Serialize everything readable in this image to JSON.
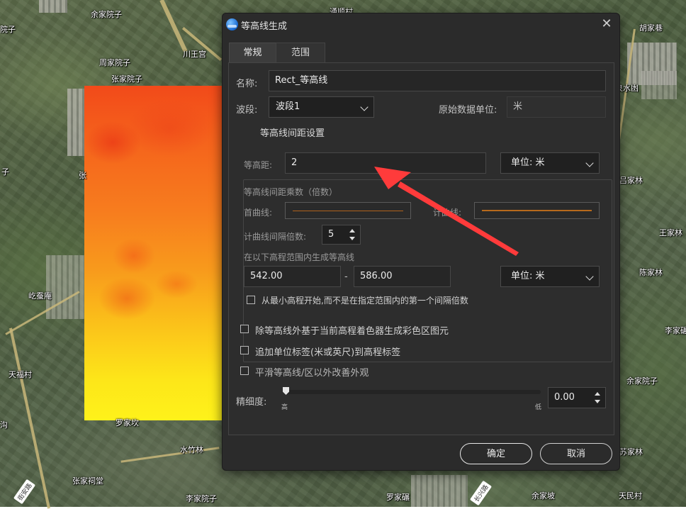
{
  "map": {
    "places": [
      {
        "id": "p1",
        "text": "余家院子"
      },
      {
        "id": "p2",
        "text": "通顺村"
      },
      {
        "id": "p3",
        "text": "胡家巷"
      },
      {
        "id": "p4",
        "text": "周家院子"
      },
      {
        "id": "p5",
        "text": "川王宫"
      },
      {
        "id": "p6",
        "text": "张家院子"
      },
      {
        "id": "p7",
        "text": "泉水凼"
      },
      {
        "id": "p8",
        "text": "吕家林"
      },
      {
        "id": "p9",
        "text": "王家林"
      },
      {
        "id": "p10",
        "text": "陈家林"
      },
      {
        "id": "p11",
        "text": "屹蚕庵"
      },
      {
        "id": "p12",
        "text": "李家碾"
      },
      {
        "id": "p13",
        "text": "天福村"
      },
      {
        "id": "p14",
        "text": "余家院子"
      },
      {
        "id": "p15",
        "text": "罗家坎"
      },
      {
        "id": "p16",
        "text": "水竹林"
      },
      {
        "id": "p17",
        "text": "张家祠堂"
      },
      {
        "id": "p18",
        "text": "李家院子"
      },
      {
        "id": "p19",
        "text": "罗家碾"
      },
      {
        "id": "p20",
        "text": "余家坡"
      },
      {
        "id": "p21",
        "text": "天民村"
      },
      {
        "id": "p22",
        "text": "苏家林"
      },
      {
        "id": "p23",
        "text": "沟"
      },
      {
        "id": "p24",
        "text": "子"
      },
      {
        "id": "p25",
        "text": "院子"
      },
      {
        "id": "p26",
        "text": "张"
      }
    ],
    "road_labels": [
      "街安路",
      "长兴路"
    ]
  },
  "dialog": {
    "title": "等高线生成",
    "close": "✕",
    "tabs": [
      {
        "label": "常规",
        "active": true
      },
      {
        "label": "范围",
        "active": false
      }
    ],
    "name_label": "名称:",
    "name_value": "Rect_等高线",
    "band_label": "波段:",
    "band_value": "波段1",
    "raw_unit_label": "原始数据单位:",
    "raw_unit_value": "米",
    "group_title": "等高线间距设置",
    "interval_label": "等高距:",
    "interval_value": "2",
    "interval_unit": "单位: 米",
    "multiplier_title": "等高线间距乘数（倍数）",
    "first_curve_label": "首曲线:",
    "count_curve_label": "计曲线:",
    "count_interval_label": "计曲线间隔倍数:",
    "count_interval_value": "5",
    "range_title": "在以下高程范围内生成等高线",
    "range_min": "542.00",
    "range_sep": "-",
    "range_max": "586.00",
    "range_unit": "单位: 米",
    "start_min_label": "从最小高程开始,而不是在指定范围内的第一个间隔倍数",
    "opt_color_fill": "除等高线外基于当前高程着色器生成彩色区图元",
    "opt_unit_label": "追加单位标签(米或英尺)到高程标签",
    "opt_smooth": "平滑等高线/区以外改善外观",
    "precision_label": "精细度:",
    "precision_value": "0.00",
    "slider_high": "高",
    "slider_low": "低",
    "ok": "确定",
    "cancel": "取消"
  },
  "colors": {
    "dialog_bg": "#2b2b2b",
    "accent_arrow": "#ff3b3b",
    "heat_top": "#f24a1a",
    "heat_bottom": "#fef21a"
  }
}
